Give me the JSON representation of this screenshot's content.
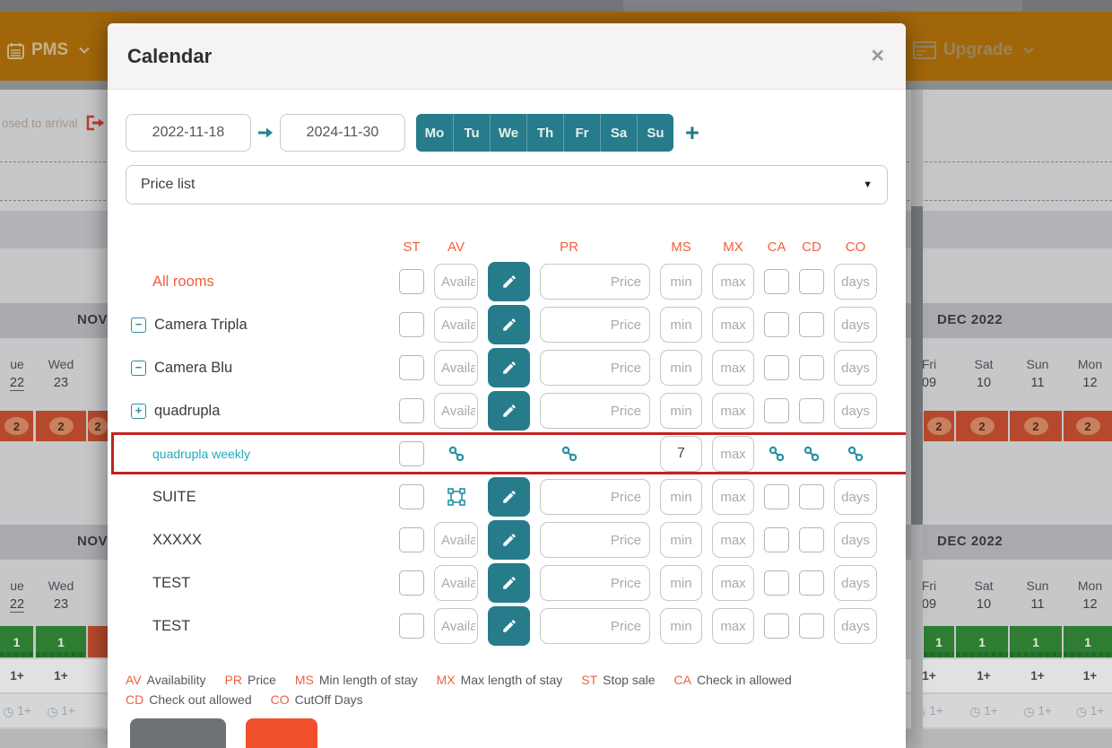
{
  "topbar": {
    "pms": "PMS",
    "upgrade": "Upgrade"
  },
  "background": {
    "closed_to_arrival_text": "osed to arrival",
    "left_month": "NOV",
    "right_month": "DEC 2022",
    "left_days": [
      {
        "name": "ue",
        "num": "22"
      },
      {
        "name": "Wed",
        "num": "23"
      }
    ],
    "right_days": [
      {
        "name": "Fri",
        "num": "09"
      },
      {
        "name": "Sat",
        "num": "10"
      },
      {
        "name": "Sun",
        "num": "11"
      },
      {
        "name": "Mon",
        "num": "12"
      }
    ],
    "occupancy_value": "2",
    "availability_value": "1",
    "min_stay_value": "1+",
    "cutoff_clock_value": "1+"
  },
  "modal": {
    "title": "Calendar",
    "close": "×",
    "date_from": "2022-11-18",
    "date_to": "2024-11-30",
    "weekdays": [
      "Mo",
      "Tu",
      "We",
      "Th",
      "Fr",
      "Sa",
      "Su"
    ],
    "add_day": "+",
    "price_list": "Price list",
    "caret": "▼",
    "columns": {
      "st": "ST",
      "av": "AV",
      "pr": "PR",
      "ms": "MS",
      "mx": "MX",
      "ca": "CA",
      "cd": "CD",
      "co": "CO"
    },
    "placeholders": {
      "availability": "Availa",
      "price": "Price",
      "min": "min",
      "max": "max",
      "days": "days"
    },
    "rows": [
      {
        "name": "All rooms"
      },
      {
        "name": "Camera Tripla"
      },
      {
        "name": "Camera Blu"
      },
      {
        "name": "quadrupla"
      },
      {
        "name": "quadrupla weekly",
        "min_value": "7"
      },
      {
        "name": "SUITE"
      },
      {
        "name": "XXXXX"
      },
      {
        "name": "TEST"
      },
      {
        "name": "TEST"
      }
    ],
    "legend": [
      {
        "abbr": "AV",
        "label": "Availability"
      },
      {
        "abbr": "PR",
        "label": "Price"
      },
      {
        "abbr": "MS",
        "label": "Min length of stay"
      },
      {
        "abbr": "MX",
        "label": "Max length of stay"
      },
      {
        "abbr": "ST",
        "label": "Stop sale"
      },
      {
        "abbr": "CA",
        "label": "Check in allowed"
      },
      {
        "abbr": "CD",
        "label": "Check out allowed"
      },
      {
        "abbr": "CO",
        "label": "CutOff Days"
      }
    ]
  }
}
